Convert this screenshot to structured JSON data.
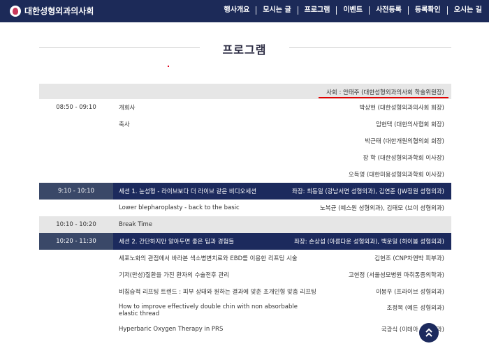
{
  "header": {
    "logo_text": "대한성형외과의사회",
    "nav": [
      "행사개요",
      "모시는 글",
      "프로그램",
      "이벤트",
      "사전등록",
      "등록확인",
      "오시는 길"
    ]
  },
  "section": {
    "title": "프로그램"
  },
  "moderator": "사회 : 안태주 (대한성형외과의사회 학술위원장)",
  "opening": {
    "time": "08:50 - 09:10",
    "items": [
      {
        "title": "개회사",
        "person": "박상현 (대한성형외과의사회 회장)"
      },
      {
        "title": "축사",
        "person": "임현택 (대한의사협회 회장)"
      },
      {
        "title": "",
        "person": "박근태 (대한개원의협의회 회장)"
      },
      {
        "title": "",
        "person": "장 학 (대한성형외과학회 이사장)"
      },
      {
        "title": "",
        "person": "오득영 (대한미용성형외과학회 이사장)"
      }
    ]
  },
  "session1": {
    "time": "9:10 - 10:10",
    "title": "세션 1. 눈성형 - 라이브보다 더 라이브 같은 비디오세션",
    "chairs": "좌장: 최동일 (강남서면 성형외과), 김연준 (JW정원 성형외과)",
    "talk": {
      "title": "Lower blepharoplasty - back to the basic",
      "person": "노복균 (예스원 성형외과), 김태모 (브이 성형외과)"
    }
  },
  "break": {
    "time": "10:10 - 10:20",
    "label": "Break Time"
  },
  "session2": {
    "time": "10:20 - 11:30",
    "title": "세션 2. 간단하지만 알아두면 좋은 팁과 경험들",
    "chairs": "좌장: 손상섭 (아름다운 성형외과), 백운일 (하이봄 성형외과)",
    "talks": [
      {
        "title": "세포노화의 관점에서 바라본 색소병변치료와 EBD를 이용한 리프팅 시술",
        "person": "김현조 (CNP차앤박 피부과)"
      },
      {
        "title": "기저(만성)질환을 가진 환자의 수술전후 관리",
        "person": "고현정 (서울성모병원 마취통증의학과)"
      },
      {
        "title": "비침습적 리프팅 트렌드 : 피부 상태와 원하는 결과에 맞춘 초개인형 맞춤 리프팅",
        "person": "이봉우 (프라이브 성형외과)"
      },
      {
        "title": "How to improve effectively double chin with non absorbable elastic thread",
        "person": "조정목 (예튼 성형외과)"
      },
      {
        "title": "Hyperbaric Oxygen Therapy in PRS",
        "person": "국광식 (이데아 성형외과)"
      }
    ]
  }
}
